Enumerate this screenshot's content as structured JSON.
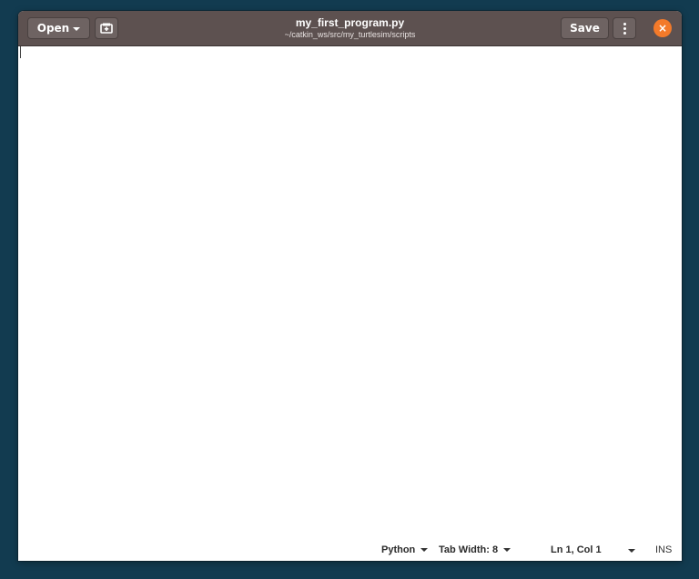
{
  "header": {
    "open_label": "Open",
    "title": "my_first_program.py",
    "subtitle": "~/catkin_ws/src/my_turtlesim/scripts",
    "save_label": "Save",
    "close_glyph": "×",
    "icons": {
      "open_dropdown": "chevron-down-icon",
      "new_tab": "new-document-icon",
      "menu": "vertical-dots-icon",
      "close": "close-icon"
    },
    "colors": {
      "headerbar": "#5d5150",
      "close_button": "#f37a2a"
    }
  },
  "editor": {
    "content": ""
  },
  "statusbar": {
    "language": "Python",
    "tab_width": "Tab Width: 8",
    "cursor_position": "Ln 1, Col 1",
    "insert_mode": "INS"
  },
  "desktop": {
    "background": "#123b50"
  }
}
